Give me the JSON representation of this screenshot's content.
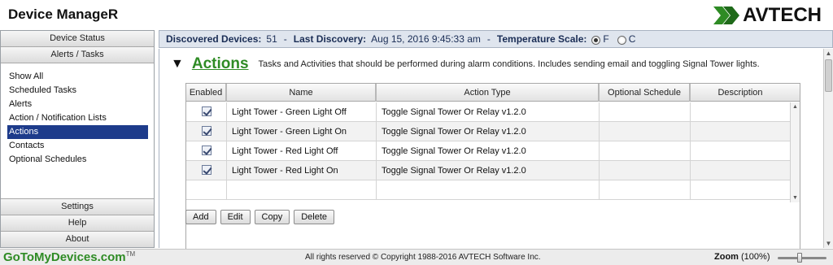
{
  "app": {
    "title": "Device ManageR",
    "brand": "AVTECH"
  },
  "sidebar": {
    "top_buttons": [
      "Device Status",
      "Alerts / Tasks"
    ],
    "items": [
      {
        "label": "Show All",
        "active": false
      },
      {
        "label": "Scheduled Tasks",
        "active": false
      },
      {
        "label": "Alerts",
        "active": false
      },
      {
        "label": "Action / Notification Lists",
        "active": false
      },
      {
        "label": "Actions",
        "active": true
      },
      {
        "label": "Contacts",
        "active": false
      },
      {
        "label": "Optional Schedules",
        "active": false
      }
    ],
    "bottom_buttons": [
      "Settings",
      "Help",
      "About"
    ]
  },
  "status": {
    "discovered_label": "Discovered Devices:",
    "discovered_value": "51",
    "last_label": "Last Discovery:",
    "last_value": "Aug 15, 2016  9:45:33 am",
    "temp_label": "Temperature Scale:",
    "temp_f": "F",
    "temp_c": "C",
    "temp_selected": "F"
  },
  "section": {
    "title": "Actions",
    "description": "Tasks and Activities that should be performed during alarm conditions. Includes sending email and toggling Signal Tower lights."
  },
  "table": {
    "columns": [
      "Enabled",
      "Name",
      "Action Type",
      "Optional Schedule",
      "Description"
    ],
    "rows": [
      {
        "enabled": true,
        "name": "Light Tower - Green Light Off",
        "action_type": "Toggle Signal Tower Or Relay v1.2.0",
        "schedule": "",
        "description": ""
      },
      {
        "enabled": true,
        "name": "Light Tower - Green Light On",
        "action_type": "Toggle Signal Tower Or Relay v1.2.0",
        "schedule": "",
        "description": ""
      },
      {
        "enabled": true,
        "name": "Light Tower - Red Light Off",
        "action_type": "Toggle Signal Tower Or Relay v1.2.0",
        "schedule": "",
        "description": ""
      },
      {
        "enabled": true,
        "name": "Light Tower - Red Light On",
        "action_type": "Toggle Signal Tower Or Relay v1.2.0",
        "schedule": "",
        "description": ""
      }
    ]
  },
  "buttons": {
    "add": "Add",
    "edit": "Edit",
    "copy": "Copy",
    "delete": "Delete"
  },
  "footer": {
    "brand": "GoToMyDevices.com",
    "trademark": "TM",
    "copyright": "All rights reserved © Copyright 1988-2016 AVTECH Software Inc.",
    "zoom_label": "Zoom",
    "zoom_value": "(100%)",
    "zoom_fraction": 0.45
  },
  "colors": {
    "accent_green": "#2e8b24",
    "active_blue": "#1d3b8b",
    "status_text": "#1a2d55"
  }
}
